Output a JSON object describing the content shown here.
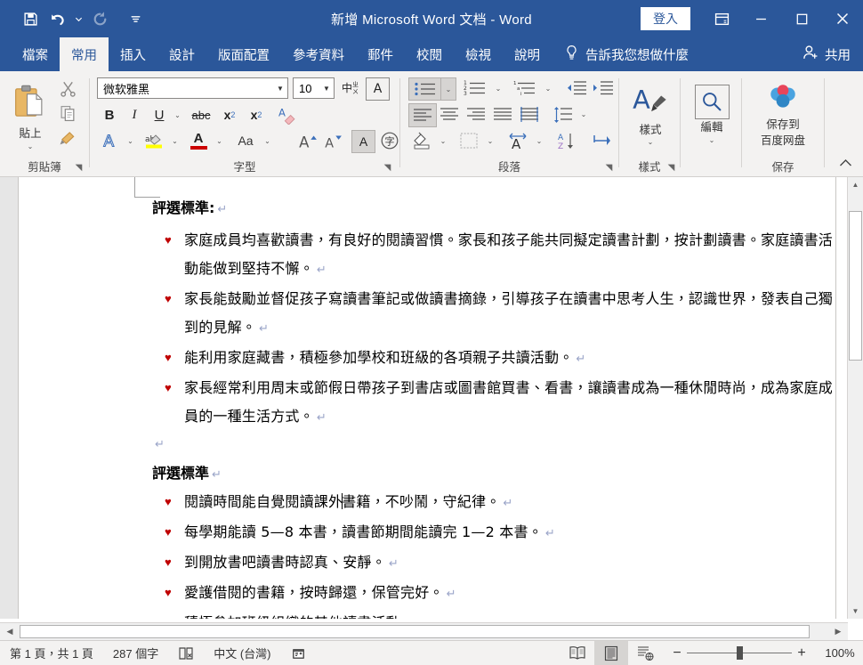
{
  "titlebar": {
    "document_title": "新增 Microsoft Word 文档 - Word",
    "signin_label": "登入",
    "quick_access": [
      {
        "name": "save-icon",
        "label": "儲存"
      },
      {
        "name": "undo-icon",
        "label": "復原"
      },
      {
        "name": "undo-dropdown-icon",
        "label": "復原選項"
      },
      {
        "name": "redo-icon",
        "label": "取消復原"
      },
      {
        "name": "customize-qat-icon",
        "label": "自訂快速存取工具列"
      }
    ],
    "window_controls": {
      "ribbon_display": "功能區顯示選項",
      "minimize": "最小化",
      "maximize": "最大化",
      "close": "關閉"
    }
  },
  "tabs": [
    {
      "label": "檔案",
      "active": false
    },
    {
      "label": "常用",
      "active": true
    },
    {
      "label": "插入",
      "active": false
    },
    {
      "label": "設計",
      "active": false
    },
    {
      "label": "版面配置",
      "active": false
    },
    {
      "label": "參考資料",
      "active": false
    },
    {
      "label": "郵件",
      "active": false
    },
    {
      "label": "校閱",
      "active": false
    },
    {
      "label": "檢視",
      "active": false
    },
    {
      "label": "說明",
      "active": false
    }
  ],
  "tell_me": {
    "label": "告訴我您想做什麼",
    "icon": "lightbulb-icon"
  },
  "share": {
    "label": "共用",
    "icon": "person-share-icon"
  },
  "ribbon": {
    "groups": [
      {
        "name": "clipboard",
        "label": "剪貼簿"
      },
      {
        "name": "font",
        "label": "字型"
      },
      {
        "name": "paragraph",
        "label": "段落"
      },
      {
        "name": "styles",
        "label": "樣式"
      },
      {
        "name": "save",
        "label": "保存"
      }
    ],
    "clipboard": {
      "paste_label": "貼上",
      "cut_label": "剪下",
      "copy_label": "複製",
      "format_painter_label": "複製格式"
    },
    "font": {
      "font_name": "微软雅黑",
      "font_size": "10",
      "phonetic_guide_label": "注音標示",
      "character_border_label": "字元框線",
      "bold_label": "B",
      "italic_label": "I",
      "underline_label": "U",
      "strikethrough_label": "abc",
      "subscript_label": "x₂",
      "superscript_label": "x²",
      "clear_formatting_label": "清除所有格式設定",
      "text_effects_label": "文字效果與印刷樣式",
      "highlight_label": "文字醒目提示色彩",
      "font_color_label": "字型色彩",
      "change_case_label": "Aa",
      "grow_font_label": "放大字型",
      "shrink_font_label": "縮小字型",
      "character_shading_label": "字元網底",
      "enclose_char_label": "圍繞字元"
    },
    "paragraph": {
      "bullets_label": "項目符號",
      "numbering_label": "編號",
      "multilevel_label": "多層次清單",
      "decrease_indent_label": "減少縮排",
      "increase_indent_label": "增加縮排",
      "align_left_label": "靠左對齊",
      "align_center_label": "置中",
      "align_right_label": "靠右對齊",
      "justify_label": "左右對齊",
      "distribute_label": "分散對齊",
      "line_spacing_label": "行距與段落間距",
      "shading_label": "網底",
      "borders_label": "框線",
      "asian_layout_label": "亞洲方式配置",
      "sort_label": "排序",
      "show_marks_label": "顯示/隱藏編輯標記"
    },
    "styles": {
      "button_label": "樣式"
    },
    "editing": {
      "button_label": "編輯"
    },
    "save_group": {
      "button_label_line1": "保存到",
      "button_label_line2": "百度网盘"
    },
    "collapse_ribbon_label": "摺疊功能區"
  },
  "document": {
    "heading1": "評選標準:",
    "list1": [
      "家庭成員均喜歡讀書，有良好的閱讀習慣。家長和孩子能共同擬定讀書計劃，按計劃讀書。家庭讀書活動能做到堅持不懈。",
      "家長能鼓勵並督促孩子寫讀書筆記或做讀書摘錄，引導孩子在讀書中思考人生，認識世界，發表自己獨到的見解。",
      "能利用家庭藏書，積極參加學校和班級的各項親子共讀活動。",
      "家長經常利用周末或節假日帶孩子到書店或圖書館買書、看書，讓讀書成為一種休閒時尚，成為家庭成員的一種生活方式。"
    ],
    "heading2": "評選標準",
    "list2_part_a": "閱讀時間能自覺閱讀課外",
    "list2_part_b": "書籍，不吵鬧，守紀律。",
    "list2_rest": [
      "每學期能讀 5—8 本書，讀書節期間能讀完 1—2 本書。",
      "到開放書吧讀書時認真、安靜。",
      "愛護借閱的書籍，按時歸還，保管完好。",
      "積極參加班級組織的其他讀書活動。"
    ],
    "bullet_glyph": "♥",
    "pilcrow_glyph": "↵"
  },
  "statusbar": {
    "page_info": "第 1 頁，共 1 頁",
    "word_count": "287 個字",
    "proofing_label": "校訂狀態",
    "language": "中文 (台灣)",
    "accessibility_label": "協助工具檢查程式",
    "views": [
      {
        "name": "read-mode",
        "label": "閱讀模式",
        "active": false
      },
      {
        "name": "print-layout",
        "label": "整頁模式",
        "active": true
      },
      {
        "name": "web-layout",
        "label": "Web 版面配置",
        "active": false
      }
    ],
    "zoom_out_label": "−",
    "zoom_in_label": "+",
    "zoom_level": "100%"
  },
  "colors": {
    "word_blue": "#2b579a",
    "ribbon_bg": "#f3f2f1",
    "bullet_red": "#c00000",
    "accent_blue": "#2b579a"
  }
}
